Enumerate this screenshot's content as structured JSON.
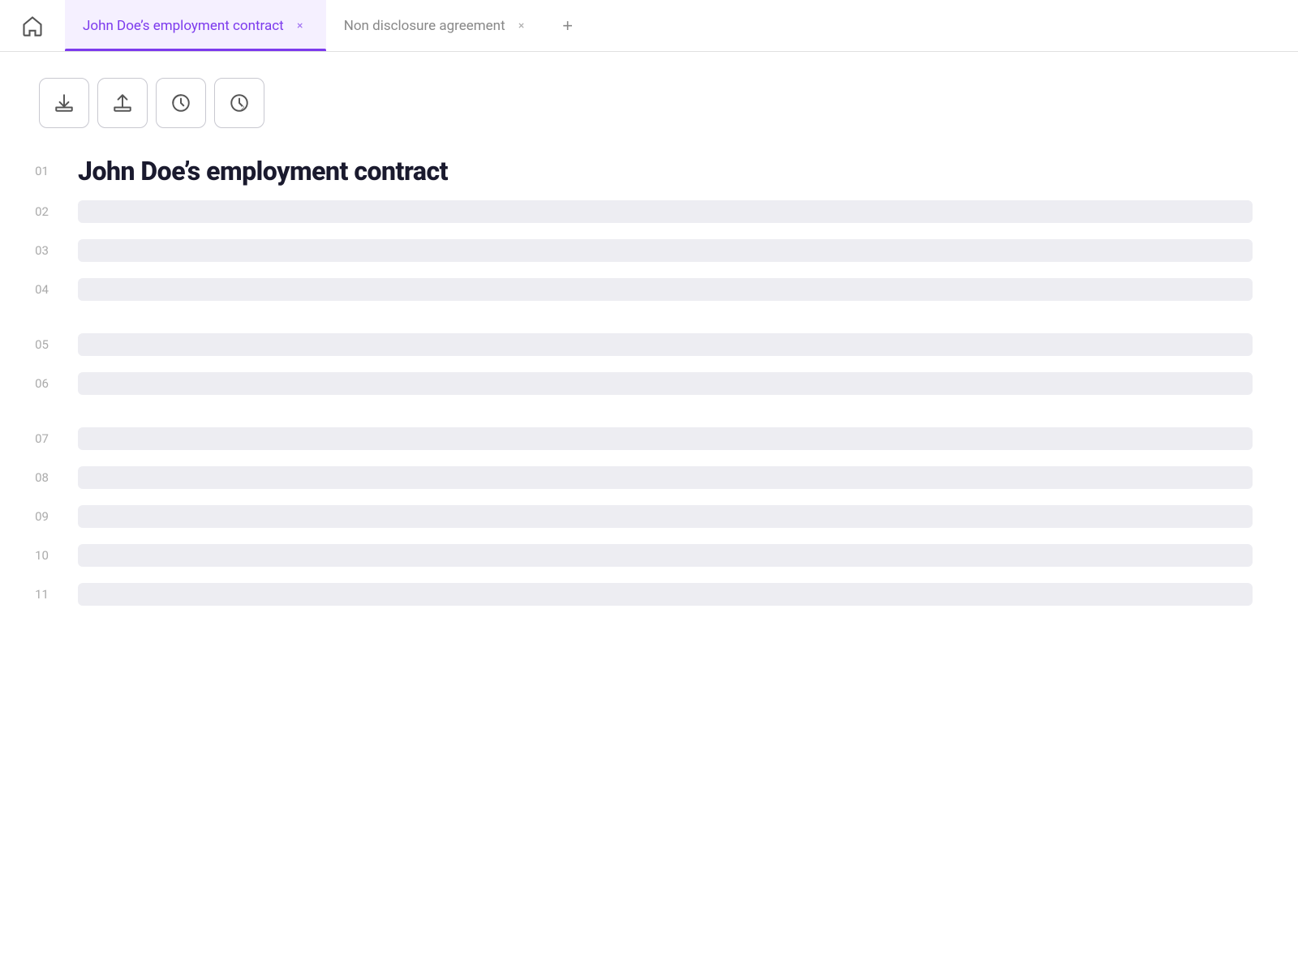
{
  "tabs": [
    {
      "id": "tab-1",
      "label": "John Doe’s employment contract",
      "active": true,
      "closable": true
    },
    {
      "id": "tab-2",
      "label": "Non disclosure agreement",
      "active": false,
      "closable": true
    }
  ],
  "home_icon": "home",
  "add_tab_label": "+",
  "toolbar": {
    "buttons": [
      {
        "id": "download",
        "icon": "download",
        "label": "Download"
      },
      {
        "id": "upload",
        "icon": "upload",
        "label": "Upload"
      },
      {
        "id": "history1",
        "icon": "history",
        "label": "History 1"
      },
      {
        "id": "history2",
        "icon": "history2",
        "label": "History 2"
      }
    ]
  },
  "document": {
    "title": "John Doe’s employment contract",
    "lines": [
      {
        "num": "01",
        "type": "title"
      },
      {
        "num": "02",
        "type": "placeholder"
      },
      {
        "num": "03",
        "type": "placeholder"
      },
      {
        "num": "04",
        "type": "placeholder"
      },
      {
        "num": "",
        "type": "gap"
      },
      {
        "num": "05",
        "type": "placeholder"
      },
      {
        "num": "06",
        "type": "placeholder"
      },
      {
        "num": "",
        "type": "gap"
      },
      {
        "num": "07",
        "type": "placeholder"
      },
      {
        "num": "08",
        "type": "placeholder"
      },
      {
        "num": "09",
        "type": "placeholder"
      },
      {
        "num": "10",
        "type": "placeholder"
      },
      {
        "num": "11",
        "type": "placeholder"
      }
    ]
  },
  "colors": {
    "active_tab": "#7c3aed",
    "active_tab_bg": "#f5f0ff",
    "placeholder_bg": "#ededf2"
  }
}
